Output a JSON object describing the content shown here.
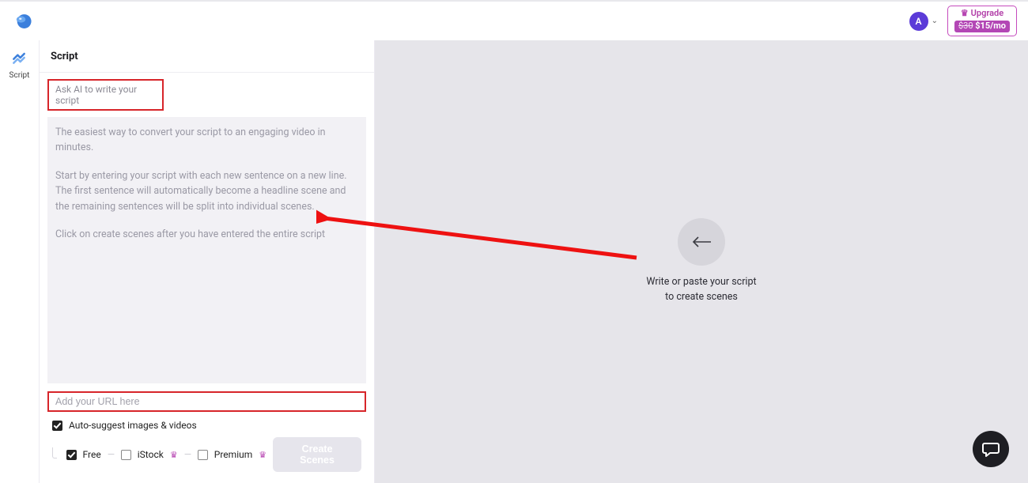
{
  "header": {
    "avatar_initial": "A",
    "upgrade_label": "Upgrade",
    "upgrade_old_price": "$30",
    "upgrade_new_price": "$15/mo"
  },
  "rail": {
    "script_label": "Script"
  },
  "panel": {
    "title": "Script",
    "ask_ai_label": "Ask AI to write your script",
    "placeholder_p1": "The easiest way to convert your script to an engaging video in minutes.",
    "placeholder_p2": "Start by entering your script with each new sentence on a new line. The first sentence will automatically become a headline scene and the remaining sentences will be split into individual scenes.",
    "placeholder_p3": "Click on create scenes after you have entered the entire script",
    "url_placeholder": "Add your URL here",
    "auto_suggest_label": "Auto-suggest images & videos",
    "opt_free": "Free",
    "opt_istock": "iStock",
    "opt_premium": "Premium",
    "create_btn": "Create Scenes"
  },
  "canvas": {
    "placeholder_text_l1": "Write or paste your script",
    "placeholder_text_l2": "to create scenes"
  }
}
